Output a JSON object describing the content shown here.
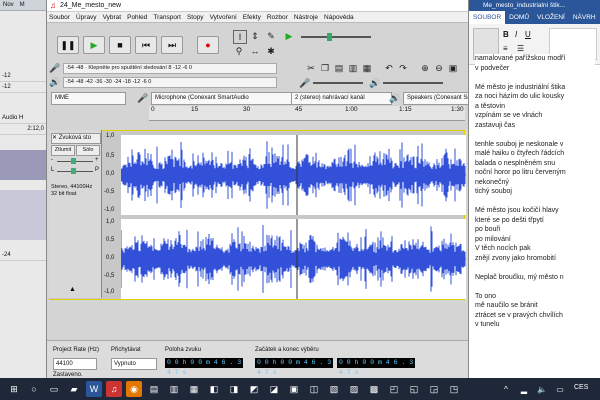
{
  "bg_app": {
    "tab_label": "Nov",
    "tab_letter": "M",
    "rows": [
      "-12",
      "-12",
      "-24"
    ],
    "side_label": "Audio H",
    "side_time": "2:12,0"
  },
  "audacity": {
    "title": "24_Me_mesto_new",
    "menu": [
      "Soubor",
      "Úpravy",
      "Vybrat",
      "Pohled",
      "Transport",
      "Stopy",
      "Vytvoření",
      "Efekty",
      "Rozbor",
      "Nástroje",
      "Nápověda"
    ],
    "meter_record": {
      "scale": "-54  -48  ·  Klepněte pro spuštění sledování  8  -12  -6  0"
    },
    "meter_play": {
      "scale": "-54  -48  -42  -36  -30  -24  -18  -12  -6  0"
    },
    "devices": {
      "host": "MME",
      "input": "Microphone (Conexant SmartAudio",
      "channels": "2 (stereo) nahrávací kanál",
      "output": "Speakers (Conexant Smart"
    },
    "ruler_ticks": [
      "15",
      "30",
      "45",
      "1:00",
      "1:15",
      "1:30"
    ],
    "ruler_start": "0",
    "track": {
      "name": "Zvuková sto",
      "mute": "Ztlumit",
      "solo": "Sólo",
      "gain_left": "-",
      "gain_right": "+",
      "pan_left": "L",
      "pan_right": "P",
      "info_line1": "Stereo, 44100Hz",
      "info_line2": "32 bit float",
      "scale": [
        "1,0",
        "0,5",
        "0,0",
        "-0,5",
        "-1,0",
        "1,0",
        "0,5",
        "0,0",
        "-0,5",
        "-1,0"
      ]
    },
    "bottom": {
      "rate_label": "Project Rate (Hz)",
      "rate_value": "44100",
      "snap_label": "Přichytávat",
      "snap_value": "Vypnuto",
      "position_label": "Poloha zvuku",
      "position_value": "0 0 h 0 0 m 4 6 . 3 4 7 s",
      "selection_label": "Začátek a konec výběru",
      "selection_start": "0 0 h 0 0 m 4 6 . 3 4 7 s",
      "selection_end": "0 0 h 0 0 m 4 6 . 3 4 7 s",
      "status": "Zastaveno."
    }
  },
  "word": {
    "title": "Me_mesto_industrialni štik...",
    "tabs": [
      "SOUBOR",
      "DOMŮ",
      "VLOŽENÍ",
      "NÁVRH"
    ],
    "lines": [
      "namalované pařížskou modří",
      "v podvečer",
      "",
      "Mé město je industriální štika",
      "za noci házím do ulic kousky",
      "a těstovin",
      "vzpínám se ve vlnách",
      "zastavuji čas",
      "",
      "tenhle souboj je neskonale v",
      "malé haiku o čtyřech řádcích",
      "balada o nesplněném snu",
      "noční horor po litru červeným",
      "nekonečný",
      "tichý souboj",
      "",
      "Mé město jsou kočičí hlavy",
      "které se po dešti třpytí",
      "            po bouři",
      "            po milování",
      "V těch nocích pak",
      "znějí zvony jako hromobití",
      "",
      "Neplač broučku, mý město n",
      "",
      "To ono",
      "mě naučilo se bránit",
      "ztrácet se v pravých chvílích",
      "v tunelu"
    ]
  },
  "taskbar": {
    "lang": "CES"
  }
}
